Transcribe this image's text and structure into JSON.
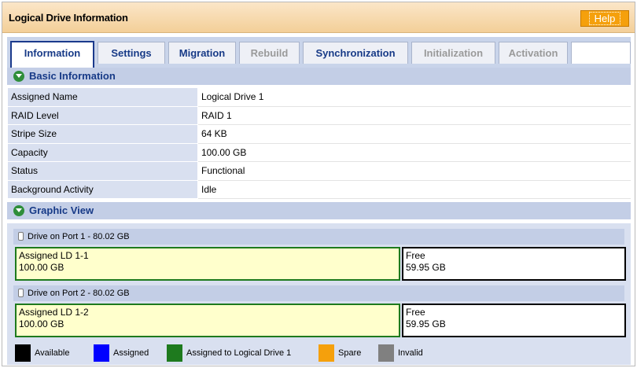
{
  "window": {
    "title": "Logical Drive Information",
    "help_label": "Help"
  },
  "tabs": [
    {
      "label": "Information",
      "state": "active"
    },
    {
      "label": "Settings",
      "state": "enabled"
    },
    {
      "label": "Migration",
      "state": "enabled"
    },
    {
      "label": "Rebuild",
      "state": "disabled"
    },
    {
      "label": "Synchronization",
      "state": "enabled"
    },
    {
      "label": "Initialization",
      "state": "disabled"
    },
    {
      "label": "Activation",
      "state": "disabled"
    }
  ],
  "basic_info": {
    "heading": "Basic Information",
    "rows": [
      {
        "label": "Assigned Name",
        "value": "Logical Drive 1"
      },
      {
        "label": "RAID Level",
        "value": "RAID 1"
      },
      {
        "label": "Stripe Size",
        "value": "64 KB"
      },
      {
        "label": "Capacity",
        "value": "100.00 GB"
      },
      {
        "label": "Status",
        "value": "Functional"
      },
      {
        "label": "Background Activity",
        "value": "Idle"
      }
    ]
  },
  "graphic_view": {
    "heading": "Graphic View",
    "drives": [
      {
        "header": "Drive on Port 1 - 80.02 GB",
        "assigned": {
          "line1": "Assigned LD 1-1",
          "line2": "100.00 GB"
        },
        "free": {
          "line1": "Free",
          "line2": "59.95 GB"
        }
      },
      {
        "header": "Drive on Port 2 - 80.02 GB",
        "assigned": {
          "line1": "Assigned LD 1-2",
          "line2": "100.00 GB"
        },
        "free": {
          "line1": "Free",
          "line2": "59.95 GB"
        }
      }
    ],
    "legend": [
      {
        "label": "Available",
        "color": "#000000"
      },
      {
        "label": "Assigned",
        "color": "#0000ff"
      },
      {
        "label": "Assigned to Logical Drive 1",
        "color": "#1e7a1e"
      },
      {
        "label": "Spare",
        "color": "#f5a00c"
      },
      {
        "label": "Invalid",
        "color": "#808080"
      }
    ]
  },
  "colors": {
    "title_bar": "#f3cf98",
    "help_button": "#f5a00c",
    "tab_text": "#173a87",
    "section_header": "#c3cee6",
    "label_cell": "#d9e0f0"
  }
}
